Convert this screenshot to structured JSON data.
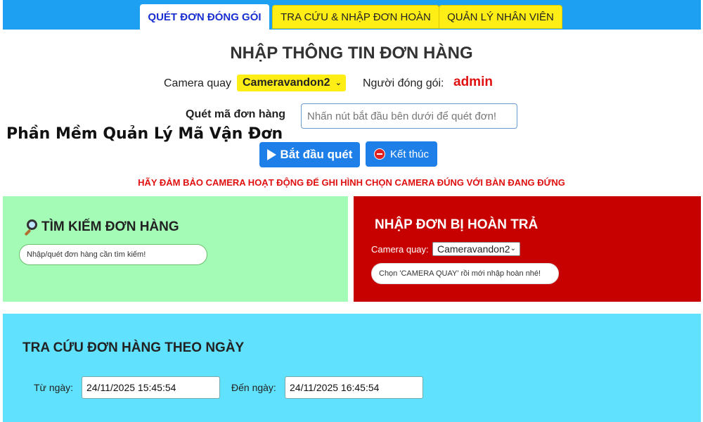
{
  "tabs": [
    {
      "label": "QUÉT ĐƠN ĐÓNG GÓI",
      "active": true
    },
    {
      "label": "TRA CỨU & NHẬP ĐƠN HOÀN",
      "active": false
    },
    {
      "label": "QUẢN LÝ NHÂN VIÊN",
      "active": false
    }
  ],
  "main": {
    "title": "NHẬP THÔNG TIN ĐƠN HÀNG",
    "camera_label": "Camera quay",
    "camera_selected": "Cameravandon2",
    "packer_label": "Người đóng gói:",
    "packer_value": "admin",
    "scan_label": "Quét mã đơn hàng",
    "scan_placeholder": "Nhấn nút bắt đầu bên dưới để quét đơn!",
    "watermark": "Phần Mềm Quản Lý Mã Vận Đơn",
    "start_button": "Bắt đầu quét",
    "stop_button": "Kết thúc",
    "warning": "HÃY ĐẢM BẢO CAMERA HOẠT ĐỘNG ĐỂ GHI HÌNH CHỌN CAMERA ĐÚNG VỚI BÀN ĐANG ĐỨNG"
  },
  "search_panel": {
    "title": "TÌM KIẾM ĐƠN HÀNG",
    "placeholder": "Nhập/quét đơn hàng cần tìm kiếm!"
  },
  "return_panel": {
    "title": "NHẬP ĐƠN BỊ HOÀN TRẢ",
    "camera_label": "Camera quay:",
    "camera_selected": "Cameravandon2",
    "placeholder": "Chọn 'CAMERA QUAY' rồi mới nhập hoàn nhé!"
  },
  "lookup_panel": {
    "title": "TRA CỨU ĐƠN HÀNG THEO NGÀY",
    "from_label": "Từ ngày:",
    "from_value": "24/11/2025 15:45:54",
    "to_label": "Đến ngày:",
    "to_value": "24/11/2025 16:45:54"
  },
  "colors": {
    "tabbar": "#1ea0f2",
    "tab_inactive": "#ffee15",
    "accent_red": "#e01010",
    "button_blue": "#1f7fe8",
    "search_bg": "#a3fbb6",
    "return_bg": "#c70000",
    "lookup_bg": "#60e1fe"
  },
  "icons": {
    "play": "play-icon",
    "stop": "stop-icon",
    "search": "magnifier-icon"
  }
}
